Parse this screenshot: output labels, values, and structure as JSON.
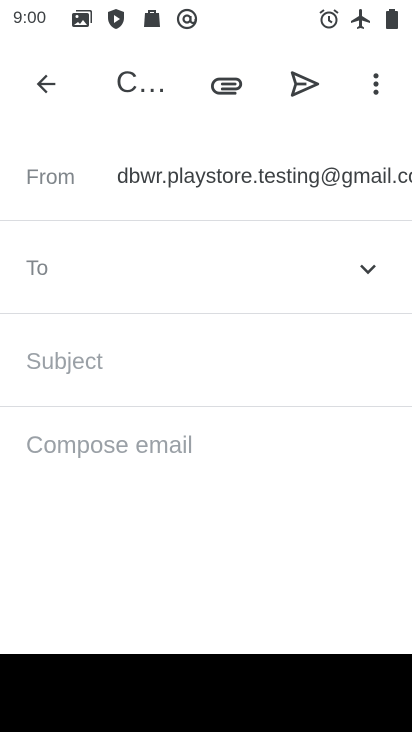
{
  "status_bar": {
    "time": "9:00",
    "icons": [
      "photos-icon",
      "play-protect-icon",
      "store-icon",
      "at-sign-icon",
      "alarm-icon",
      "airplane-mode-icon",
      "battery-icon"
    ]
  },
  "app_bar": {
    "title": "C...",
    "icons": [
      "back-arrow-icon",
      "attach-icon",
      "send-icon",
      "more-vert-icon"
    ]
  },
  "compose": {
    "from_label": "From",
    "from_value": "dbwr.playstore.testing@gmail.com",
    "to_label": "To",
    "to_value": "",
    "subject_placeholder": "Subject",
    "body_placeholder": "Compose email"
  },
  "colors": {
    "icon": "#3c4043",
    "label": "#80868b",
    "placeholder": "#9aa0a6",
    "divider": "#dadce0",
    "nav_bar": "#000000"
  }
}
